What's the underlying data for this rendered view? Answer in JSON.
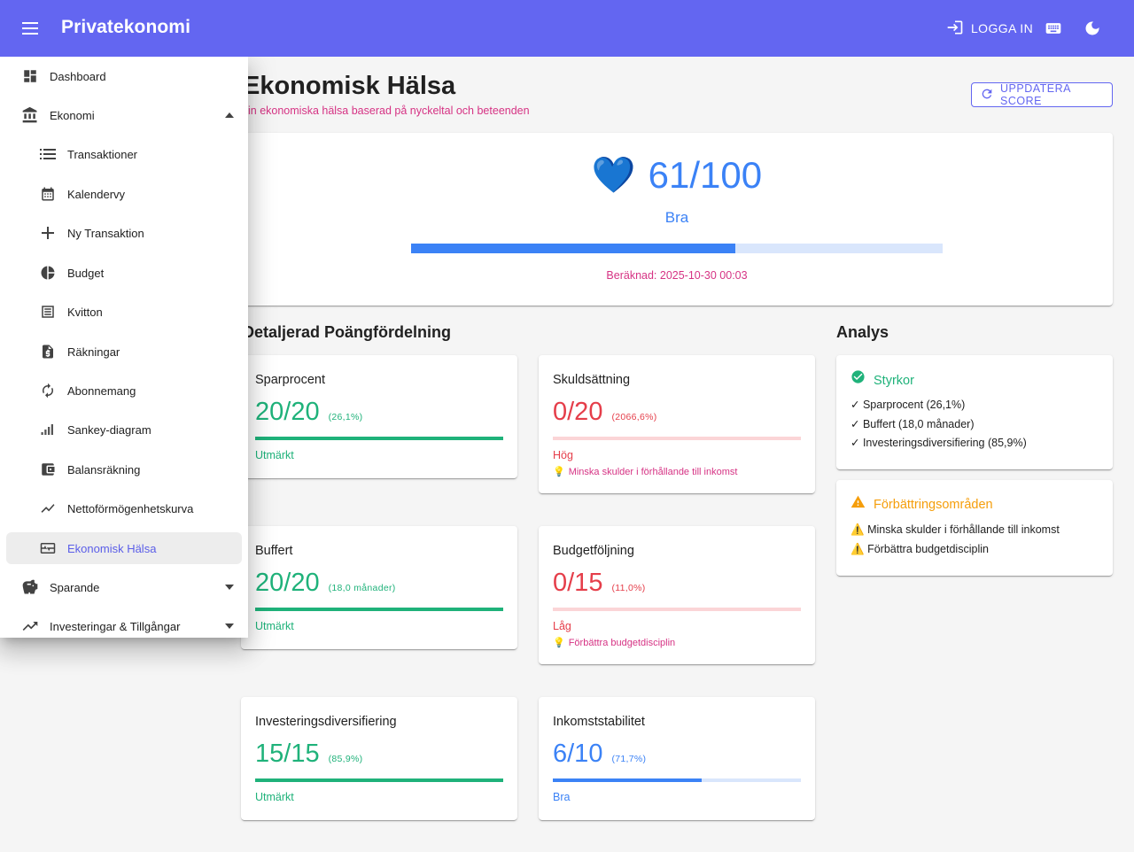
{
  "app": {
    "title": "Privatekonomi",
    "login_label": "LOGGA IN"
  },
  "nav": {
    "items": [
      {
        "label": "Dashboard"
      },
      {
        "label": "Ekonomi"
      },
      {
        "label": "Transaktioner"
      },
      {
        "label": "Kalendervy"
      },
      {
        "label": "Ny Transaktion"
      },
      {
        "label": "Budget"
      },
      {
        "label": "Kvitton"
      },
      {
        "label": "Räkningar"
      },
      {
        "label": "Abonnemang"
      },
      {
        "label": "Sankey-diagram"
      },
      {
        "label": "Balansräkning"
      },
      {
        "label": "Nettoförmögenhetskurva"
      },
      {
        "label": "Ekonomisk Hälsa"
      },
      {
        "label": "Sparande"
      },
      {
        "label": "Investeringar & Tillgångar"
      }
    ],
    "active": "Ekonomisk Hälsa"
  },
  "page": {
    "title": "Ekonomisk Hälsa",
    "subtitle": "in ekonomiska hälsa baserad på nyckeltal och beteenden",
    "update_button": "UPPDATERA SCORE"
  },
  "score": {
    "icon": "💙",
    "value": "61/100",
    "progress": 0.61,
    "label": "Bra",
    "computed": "Beräknad: 2025-10-30 00:03"
  },
  "breakdown": {
    "heading": "Detaljerad Poängfördelning",
    "metrics": [
      {
        "title": "Sparprocent",
        "score": "20/20",
        "detail": "(26,1%)",
        "fraction": 1.0,
        "status": "Utmärkt",
        "tip": ""
      },
      {
        "title": "Skuldsättning",
        "score": "0/20",
        "detail": "(2066,6%)",
        "fraction": 0.0,
        "status": "Hög",
        "tip": "Minska skulder i förhållande till inkomst"
      },
      {
        "title": "Buffert",
        "score": "20/20",
        "detail": "(18,0 månader)",
        "fraction": 1.0,
        "status": "Utmärkt",
        "tip": ""
      },
      {
        "title": "Budgetföljning",
        "score": "0/15",
        "detail": "(11,0%)",
        "fraction": 0.0,
        "status": "Låg",
        "tip": "Förbättra budgetdisciplin"
      },
      {
        "title": "Investeringsdiversifiering",
        "score": "15/15",
        "detail": "(85,9%)",
        "fraction": 1.0,
        "status": "Utmärkt",
        "tip": ""
      },
      {
        "title": "Inkomststabilitet",
        "score": "6/10",
        "detail": "(71,7%)",
        "fraction": 0.6,
        "status": "Bra",
        "tip": ""
      }
    ]
  },
  "analysis": {
    "heading": "Analys",
    "strengths": {
      "title": "Styrkor",
      "items": [
        "✓ Sparprocent (26,1%)",
        "✓ Buffert (18,0 månader)",
        "✓ Investeringsdiversifiering (85,9%)"
      ]
    },
    "improvements": {
      "title": "Förbättringsområden",
      "items": [
        "Minska skulder i förhållande till inkomst",
        "Förbättra budgetdisciplin"
      ]
    }
  },
  "colors": {
    "appbar": "#6366f1",
    "good": "#1fb27a",
    "bad": "#e53e4a",
    "ok": "#3b82f6",
    "accent": "#d63384",
    "warn": "#f59e0b"
  }
}
